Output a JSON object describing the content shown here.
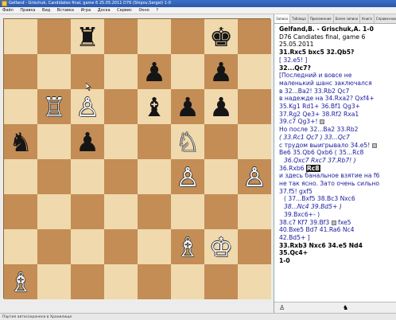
{
  "window": {
    "title": "Gelfand - Grischuk, Candidates final, game 6 25.05.2011 D76 (Shipov,Sergei) 1-0",
    "menu": [
      "Файл",
      "Правка",
      "Вид",
      "Вставка",
      "Игра",
      "Доска",
      "Сервис",
      "Окно",
      "?"
    ]
  },
  "board": {
    "rows": [
      [
        {
          "p": ""
        },
        {
          "p": ""
        },
        {
          "p": "♜",
          "c": "b",
          "n": "black-rook"
        },
        {
          "p": ""
        },
        {
          "p": ""
        },
        {
          "p": ""
        },
        {
          "p": "♚",
          "c": "b",
          "n": "black-king"
        },
        {
          "p": ""
        }
      ],
      [
        {
          "p": ""
        },
        {
          "p": ""
        },
        {
          "p": ""
        },
        {
          "p": ""
        },
        {
          "p": "♟",
          "c": "b",
          "n": "black-pawn"
        },
        {
          "p": ""
        },
        {
          "p": "♟",
          "c": "b",
          "n": "black-pawn"
        },
        {
          "p": ""
        }
      ],
      [
        {
          "p": ""
        },
        {
          "p": "♖",
          "c": "w",
          "n": "white-rook"
        },
        {
          "p": "♙",
          "c": "w",
          "n": "white-pawn"
        },
        {
          "p": ""
        },
        {
          "p": "♝",
          "c": "b",
          "n": "black-bishop"
        },
        {
          "p": "♟",
          "c": "b",
          "n": "black-pawn"
        },
        {
          "p": "♟",
          "c": "b",
          "n": "black-pawn"
        },
        {
          "p": ""
        }
      ],
      [
        {
          "p": "♞",
          "c": "b",
          "n": "black-knight"
        },
        {
          "p": ""
        },
        {
          "p": "♟",
          "c": "b",
          "n": "black-pawn"
        },
        {
          "p": ""
        },
        {
          "p": ""
        },
        {
          "p": "♘",
          "c": "w",
          "n": "white-knight"
        },
        {
          "p": ""
        },
        {
          "p": ""
        }
      ],
      [
        {
          "p": ""
        },
        {
          "p": ""
        },
        {
          "p": ""
        },
        {
          "p": ""
        },
        {
          "p": ""
        },
        {
          "p": "♙",
          "c": "w",
          "n": "white-pawn"
        },
        {
          "p": ""
        },
        {
          "p": "♙",
          "c": "w",
          "n": "white-pawn"
        }
      ],
      [
        {
          "p": ""
        },
        {
          "p": ""
        },
        {
          "p": ""
        },
        {
          "p": ""
        },
        {
          "p": ""
        },
        {
          "p": ""
        },
        {
          "p": ""
        },
        {
          "p": ""
        }
      ],
      [
        {
          "p": ""
        },
        {
          "p": ""
        },
        {
          "p": ""
        },
        {
          "p": ""
        },
        {
          "p": ""
        },
        {
          "p": "♗",
          "c": "w",
          "n": "white-bishop"
        },
        {
          "p": "♔",
          "c": "w",
          "n": "white-king"
        },
        {
          "p": ""
        }
      ],
      [
        {
          "p": "♗",
          "c": "w",
          "n": "white-bishop"
        },
        {
          "p": ""
        },
        {
          "p": ""
        },
        {
          "p": ""
        },
        {
          "p": ""
        },
        {
          "p": ""
        },
        {
          "p": ""
        },
        {
          "p": ""
        }
      ]
    ]
  },
  "tabs": [
    "Записи",
    "Таблица",
    "Приложение",
    "Более записи",
    "Книга",
    "Справочник"
  ],
  "notation": {
    "header1": "Gelfand,B. - Grischuk,A.  1-0",
    "header2": "D76 Candiates final, game 6 25.05.2011",
    "l1": "31.Rxc5  bxc5  32.Qb5?",
    "l2": "[ 32.e5! ]",
    "l3": "32...Qc7?",
    "l4": "[Последний и вовсе не",
    "l5": "маленький шанс заключался",
    "l6": "в  32...Ba2! 33.Rb2 Qc7",
    "l7": "в надежде на  34.Rxa2? Qxf4+",
    "l8": "35.Kg1 Rd1+ 36.Bf1 Qg3+",
    "l9": "37.Rg2 Qe3+ 38.Rf2 Rxa1",
    "l10": "39.c7 Qg3+! ",
    "l11": "Но после 32...Ba2 33.Rb2",
    "l12": "( 33.Rc1 Qc7 ) 33...Qc7",
    "l13": "с трудом выигрывало 34.e5! ",
    "l14": "Be6 35.Qb6 Qxb6 ( 35...Rc8",
    "l15": "36.Qxc7 Rxc7 37.Rb7! )",
    "l16a": "36.Rxb6 ",
    "l16b": "Rc8",
    "l17": "и здесь банальное взятие на f6",
    "l18": "не так ясно. Зато очень сильно",
    "l19": "37.f5! gxf5",
    "l20": "( 37...Bxf5 38.Bc3 Nxc6",
    "l21": "38...Nc4 39.Bd5+ )",
    "l22": "39.Bxc6+- )",
    "l23": "38.c7 Kf7 39.Bf3 ",
    "l23b": "fxe5",
    "l24": "40.Bxe5 Bd7 41.Ra6 Nc4",
    "l25": "42.Bd5+ ]",
    "l26": "33.Rxb3  Nxc6  34.e5  Nd4",
    "l27": "35.Qc4+",
    "l28": "1-0"
  },
  "status": "Партия автосохранена в Хранилище"
}
